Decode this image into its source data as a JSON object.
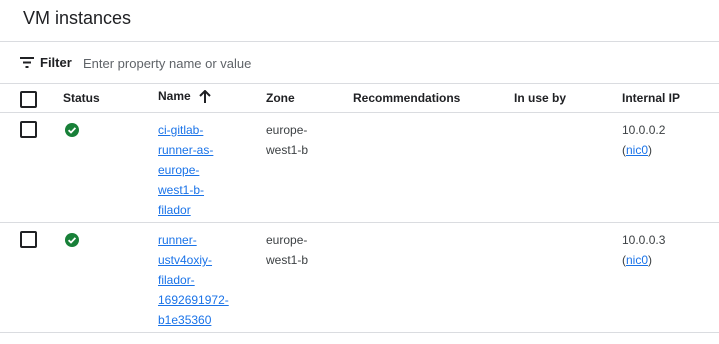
{
  "header": {
    "title": "VM instances"
  },
  "filter": {
    "label": "Filter",
    "placeholder": "Enter property name or value",
    "icon": "filter-icon"
  },
  "table": {
    "columns": {
      "status": "Status",
      "name": "Name",
      "zone": "Zone",
      "recommendations": "Recommendations",
      "in_use_by": "In use by",
      "internal_ip": "Internal IP"
    },
    "sort": {
      "column": "Name",
      "direction": "ascending",
      "icon": "arrow-up-icon"
    },
    "rows": [
      {
        "status": "running",
        "status_icon": "check-circle-icon",
        "name_lines": [
          "ci-gitlab-",
          "runner-as-",
          "europe-",
          "west1-b-",
          "filador"
        ],
        "zone_lines": [
          "europe-",
          "west1-b"
        ],
        "recommendations": "",
        "in_use_by": "",
        "ip": "10.0.0.2",
        "ip_open": "(",
        "nic": "nic0",
        "ip_close": ")"
      },
      {
        "status": "running",
        "status_icon": "check-circle-icon",
        "name_lines": [
          "runner-",
          "ustv4oxiy-",
          "filador-",
          "1692691972-",
          "b1e35360"
        ],
        "zone_lines": [
          "europe-",
          "west1-b"
        ],
        "recommendations": "",
        "in_use_by": "",
        "ip": "10.0.0.3",
        "ip_open": "(",
        "nic": "nic0",
        "ip_close": ")"
      }
    ]
  },
  "colors": {
    "link": "#1a73e8",
    "status_ok": "#188038",
    "divider": "#dadce0",
    "text": "#202124"
  }
}
